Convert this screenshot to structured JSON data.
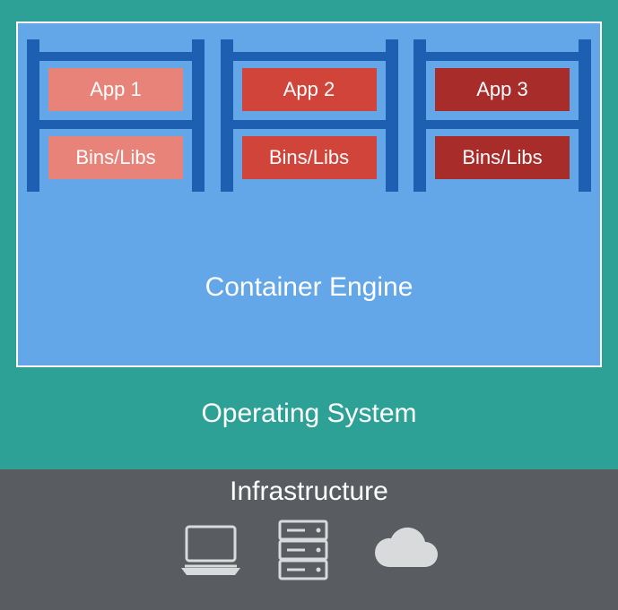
{
  "containers": [
    {
      "app": "App 1",
      "libs": "Bins/Libs"
    },
    {
      "app": "App 2",
      "libs": "Bins/Libs"
    },
    {
      "app": "App 3",
      "libs": "Bins/Libs"
    }
  ],
  "engine_label": "Container Engine",
  "os_label": "Operating System",
  "infra_label": "Infrastructure",
  "icons": {
    "laptop": "laptop-icon",
    "server": "server-icon",
    "cloud": "cloud-icon"
  }
}
